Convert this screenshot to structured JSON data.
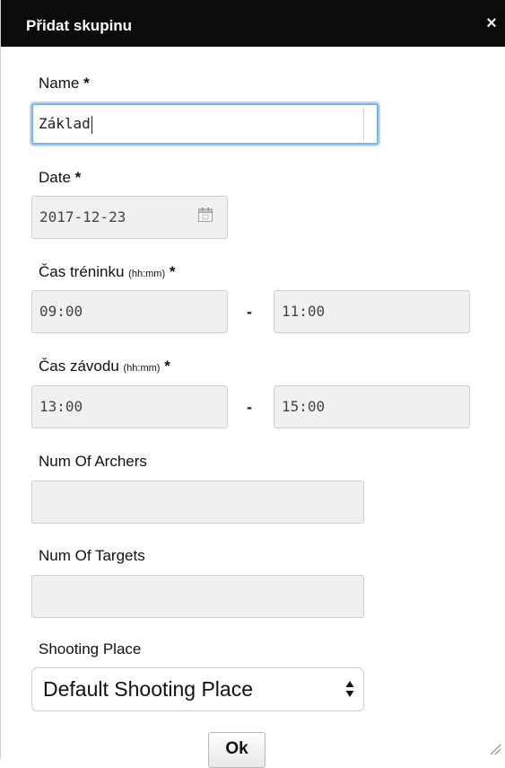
{
  "dialog": {
    "title": "Přidat skupinu",
    "close_symbol": "×"
  },
  "form": {
    "name": {
      "label": "Name",
      "required_mark": "*",
      "value": "Základ"
    },
    "date": {
      "label": "Date",
      "required_mark": "*",
      "value": "2017-12-23",
      "icon": "calendar-icon"
    },
    "training_time": {
      "label": "Čas tréninku",
      "hint": "(hh:mm)",
      "required_mark": "*",
      "from": "09:00",
      "separator": "-",
      "to": "11:00"
    },
    "race_time": {
      "label": "Čas závodu",
      "hint": "(hh:mm)",
      "required_mark": "*",
      "from": "13:00",
      "separator": "-",
      "to": "15:00"
    },
    "num_archers": {
      "label": "Num Of Archers",
      "value": ""
    },
    "num_targets": {
      "label": "Num Of Targets",
      "value": ""
    },
    "shooting_place": {
      "label": "Shooting Place",
      "selected": "Default Shooting Place"
    }
  },
  "actions": {
    "ok_label": "Ok"
  },
  "colors": {
    "titlebar": "#0b0b0b",
    "focus_ring": "#7fb2e6",
    "field_background": "#f0f0f0"
  }
}
